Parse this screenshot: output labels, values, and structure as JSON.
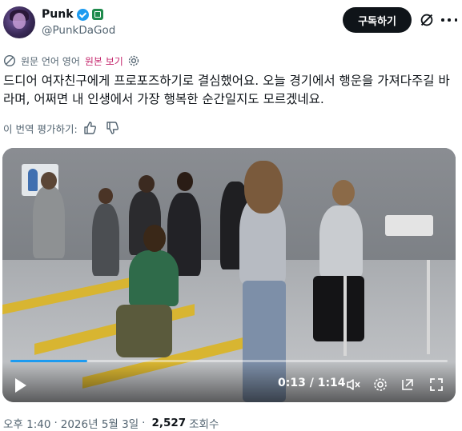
{
  "author": {
    "name": "Punk",
    "handle": "@PunkDaGod"
  },
  "header": {
    "subscribe_label": "구독하기"
  },
  "translation": {
    "source_label": "원문 언어 영어",
    "show_original_label": "원본 보기"
  },
  "tweet": {
    "text": "드디어 여자친구에게 프로포즈하기로 결심했어요. 오늘 경기에서 행운을 가져다주길 바라며, 어쩌면 내 인생에서 가장 행복한 순간일지도 모르겠네요."
  },
  "rate_translation": {
    "label": "이 번역 평가하기:"
  },
  "video": {
    "current_time": "0:13",
    "separator": "/",
    "duration": "1:14",
    "progress_fraction": 0.176
  },
  "footer": {
    "time": "오후 1:40",
    "date": "2026년 5월 3일",
    "views_count": "2,527",
    "views_label": "조회수"
  },
  "colors": {
    "accent": "#1d9bf0",
    "show_original": "#c4246b",
    "verified": "#1d9bf0"
  }
}
